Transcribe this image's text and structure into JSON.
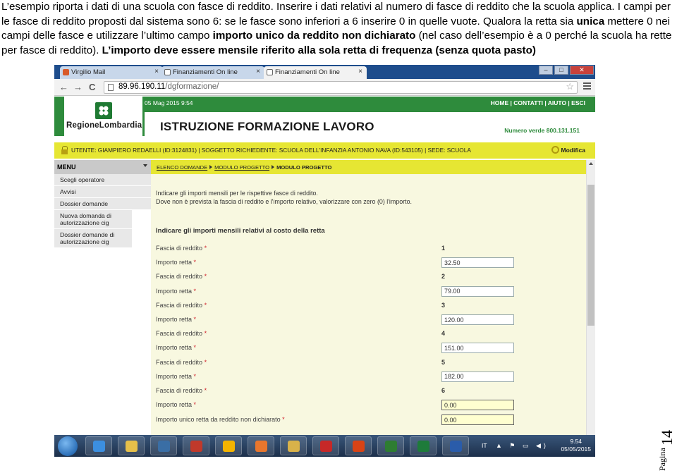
{
  "document": {
    "para_a": "L’esempio riporta i dati di una scuola con fasce di reddito. Inserire i dati relativi al numero di fasce di reddito che la scuola applica. I campi per le fasce di reddito proposti dal sistema sono 6: se le fasce sono inferiori a 6 inserire 0 in quelle vuote. Qualora la retta sia ",
    "para_b": "unica",
    "para_c": " mettere 0 nei campi delle fasce e utilizzare l’ultimo campo ",
    "para_d": "importo unico da reddito non dichiarato",
    "para_e": " (nel caso dell’esempio è a 0 perché la scuola ha rette per fasce di reddito). ",
    "para_f": "L’importo deve essere mensile riferito alla sola retta di frequenza (senza quota pasto)"
  },
  "browser": {
    "tabs": [
      {
        "label": "Virgilio Mail",
        "close": "×"
      },
      {
        "label": "Finanziamenti On line",
        "close": "×"
      },
      {
        "label": "Finanziamenti On line",
        "close": "×"
      }
    ],
    "window_buttons": [
      "–",
      "□",
      "✕"
    ],
    "nav": {
      "back": "←",
      "forward": "→",
      "reload": "C"
    },
    "address_host": "89.96.190.11",
    "address_path": "/dgformazione/",
    "star": "☆"
  },
  "site": {
    "logo_text": "RegioneLombardia",
    "date": "05 Mag 2015   9:54",
    "header_menu": "HOME  |  CONTATTI  |  AIUTO  |  ESCI",
    "title": "ISTRUZIONE FORMAZIONE LAVORO",
    "numero_verde": "Numero verde 800.131.151"
  },
  "userbar": {
    "text": "UTENTE: GIAMPIERO REDAELLI (ID:3124831)  |  SOGGETTO RICHIEDENTE: SCUOLA DELL'INFANZIA ANTONIO NAVA (ID:543105)  |  SEDE: SCUOLA",
    "modifica": "Modifica"
  },
  "menu": {
    "header": "MENU",
    "items": [
      "Scegli operatore",
      "Avvisi",
      "Dossier domande",
      "Nuova domanda di autorizzazione cig",
      "Dossier domande di autorizzazione cig"
    ]
  },
  "breadcrumb": {
    "items": [
      "ELENCO DOMANDE",
      "MODULO PROGETTO"
    ],
    "current": "MODULO PROGETTO"
  },
  "form": {
    "intro_1": "Indicare gli importi mensili per le rispettive fasce di reddito.",
    "intro_2": "Dove non è prevista la fascia di reddito e l'importo relativo, valorizzare con zero (0) l'importo.",
    "section_title": "Indicare gli importi mensili relativi al costo della retta",
    "required_mark": "*",
    "fascia_label": "Fascia di reddito",
    "importo_label": "Importo retta",
    "rows": [
      {
        "fascia": "1",
        "importo": "32.50"
      },
      {
        "fascia": "2",
        "importo": "79.00"
      },
      {
        "fascia": "3",
        "importo": "120.00"
      },
      {
        "fascia": "4",
        "importo": "151.00"
      },
      {
        "fascia": "5",
        "importo": "182.00"
      },
      {
        "fascia": "6",
        "importo": "0.00"
      }
    ],
    "unico_label": "Importo unico retta da reddito non dichiarato",
    "unico_value": "0.00"
  },
  "taskbar": {
    "lang": "IT",
    "tray_icons": "▲ ⚑ ▭ ◀)",
    "time": "9.54",
    "date": "05/05/2015",
    "apps": [
      "internet-explorer",
      "file-explorer",
      "media-player",
      "app-e",
      "chrome",
      "firefox",
      "explorer-folder",
      "acrobat",
      "app-e2",
      "app-c",
      "excel",
      "word"
    ],
    "app_colors": [
      "#3c8fe0",
      "#e6c04a",
      "#3a6ea5",
      "#c0392b",
      "#f4b400",
      "#e8762d",
      "#d9b24a",
      "#c62828",
      "#d84315",
      "#2e7d32",
      "#1e7b3a",
      "#2a5caa"
    ]
  },
  "footer": {
    "page_word": "Pagina",
    "page_number": "14"
  }
}
